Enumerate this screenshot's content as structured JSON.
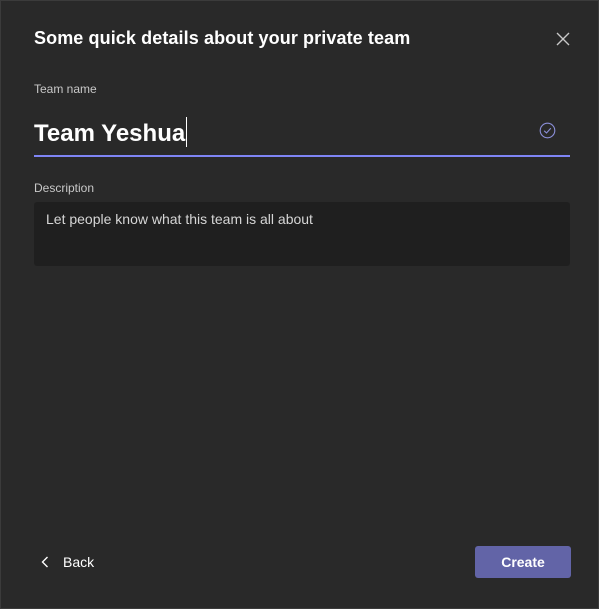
{
  "dialog": {
    "title": "Some quick details about your private team",
    "close_icon": "close-icon"
  },
  "team_name": {
    "label": "Team name",
    "value": "Team Yeshua",
    "status_icon": "check-circle-icon"
  },
  "description": {
    "label": "Description",
    "placeholder": "Let people know what this team is all about"
  },
  "footer": {
    "back_label": "Back",
    "back_icon": "chevron-left-icon",
    "create_label": "Create"
  },
  "colors": {
    "background": "#292929",
    "accent": "#6264a7",
    "input_underline": "#7f85f5",
    "input_background": "#1f1f1f"
  }
}
